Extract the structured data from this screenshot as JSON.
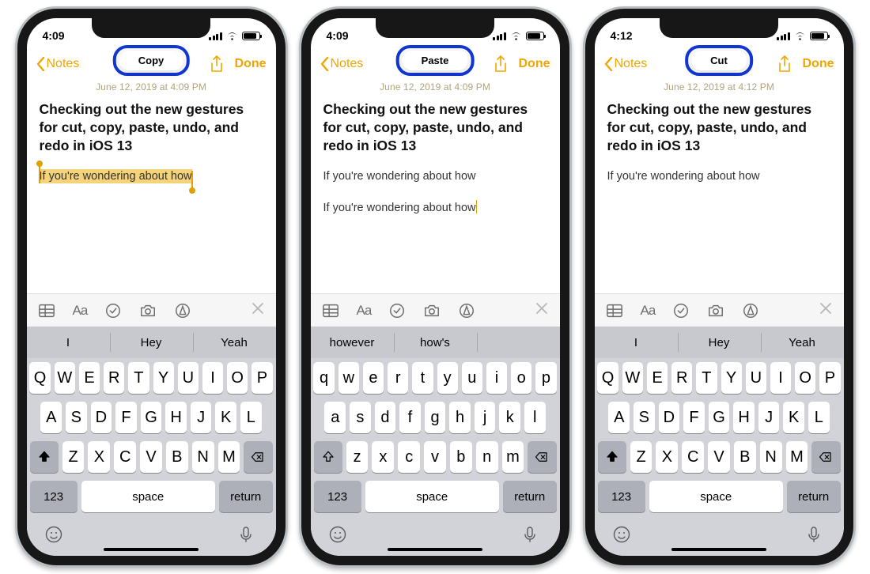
{
  "phones": [
    {
      "id": "copy",
      "status_time": "4:09",
      "toast": "Copy",
      "back_label": "Notes",
      "done_label": "Done",
      "date": "June 12, 2019 at 4:09 PM",
      "note_title": "Checking out the new gestures for cut, copy, paste, undo, and redo in  iOS 13",
      "body_lines": [
        "If you're wondering about how"
      ],
      "selection_on_line": 0,
      "caret_after_line": null,
      "keyboard_case": "upper",
      "shift_active": true,
      "predictions": [
        "I",
        "Hey",
        "Yeah"
      ],
      "row1": [
        "Q",
        "W",
        "E",
        "R",
        "T",
        "Y",
        "U",
        "I",
        "O",
        "P"
      ],
      "row2": [
        "A",
        "S",
        "D",
        "F",
        "G",
        "H",
        "J",
        "K",
        "L"
      ],
      "row3": [
        "Z",
        "X",
        "C",
        "V",
        "B",
        "N",
        "M"
      ],
      "key_123": "123",
      "key_space": "space",
      "key_return": "return"
    },
    {
      "id": "paste",
      "status_time": "4:09",
      "toast": "Paste",
      "back_label": "Notes",
      "done_label": "Done",
      "date": "June 12, 2019 at 4:09 PM",
      "note_title": "Checking out the new gestures for cut, copy, paste, undo, and redo in  iOS 13",
      "body_lines": [
        "If you're wondering about how",
        "",
        "If you're wondering about how"
      ],
      "selection_on_line": null,
      "caret_after_line": 2,
      "keyboard_case": "lower",
      "shift_active": false,
      "predictions": [
        "however",
        "how's",
        ""
      ],
      "row1": [
        "q",
        "w",
        "e",
        "r",
        "t",
        "y",
        "u",
        "i",
        "o",
        "p"
      ],
      "row2": [
        "a",
        "s",
        "d",
        "f",
        "g",
        "h",
        "j",
        "k",
        "l"
      ],
      "row3": [
        "z",
        "x",
        "c",
        "v",
        "b",
        "n",
        "m"
      ],
      "key_123": "123",
      "key_space": "space",
      "key_return": "return"
    },
    {
      "id": "cut",
      "status_time": "4:12",
      "toast": "Cut",
      "back_label": "Notes",
      "done_label": "Done",
      "date": "June 12, 2019 at 4:12 PM",
      "note_title": "Checking out the new gestures for cut, copy, paste, undo, and redo in  iOS 13",
      "body_lines": [
        "If you're wondering about how"
      ],
      "selection_on_line": null,
      "caret_after_line": null,
      "keyboard_case": "upper",
      "shift_active": true,
      "predictions": [
        "I",
        "Hey",
        "Yeah"
      ],
      "row1": [
        "Q",
        "W",
        "E",
        "R",
        "T",
        "Y",
        "U",
        "I",
        "O",
        "P"
      ],
      "row2": [
        "A",
        "S",
        "D",
        "F",
        "G",
        "H",
        "J",
        "K",
        "L"
      ],
      "row3": [
        "Z",
        "X",
        "C",
        "V",
        "B",
        "N",
        "M"
      ],
      "key_123": "123",
      "key_space": "space",
      "key_return": "return"
    }
  ]
}
